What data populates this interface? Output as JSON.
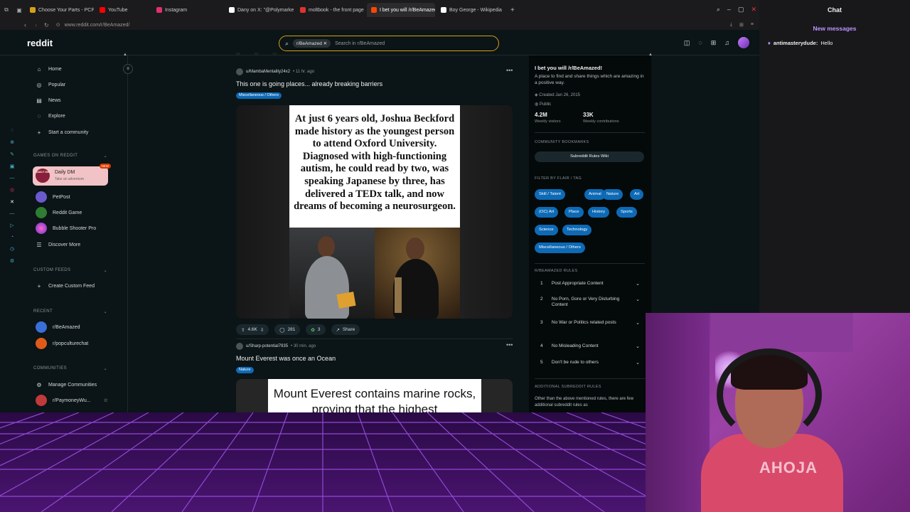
{
  "browser": {
    "tabs": [
      {
        "label": "Choose Your Parts - PCPa",
        "color": "#d4a017"
      },
      {
        "label": "YouTube",
        "color": "#ff0000"
      },
      {
        "label": "Instagram",
        "color": "#e1306c"
      },
      {
        "label": "Dany on X: \"@Polymarke",
        "color": "#ffffff"
      },
      {
        "label": "moltbook - the front page",
        "color": "#e0322f"
      },
      {
        "label": "I bet you will /r/BeAmazed",
        "color": "#ff4500"
      },
      {
        "label": "Boy George - Wikipedia",
        "color": "#ffffff"
      }
    ],
    "active_tab": 5,
    "new_tab": "+",
    "url": "www.reddit.com/r/BeAmazed/"
  },
  "header": {
    "logo": "reddit",
    "search_chip": "r/BeAmazed",
    "search_chip_close": "✕",
    "search_placeholder": "Search in r/BeAmazed"
  },
  "left_nav": {
    "items": [
      {
        "label": "Home",
        "icon": "home-icon",
        "glyph": "⌂"
      },
      {
        "label": "Popular",
        "icon": "popular-icon",
        "glyph": "◎"
      },
      {
        "label": "News",
        "icon": "news-icon",
        "glyph": "▤"
      },
      {
        "label": "Explore",
        "icon": "explore-icon",
        "glyph": "◌"
      },
      {
        "label": "Start a community",
        "icon": "plus-icon",
        "glyph": "+"
      }
    ],
    "games_heading": "GAMES ON REDDIT",
    "games": [
      {
        "label": "Daily DM",
        "sub": "Take an adventure",
        "badge": "NEW",
        "logo": "DAILY DM"
      },
      {
        "label": "PetPost"
      },
      {
        "label": "Reddit Game"
      },
      {
        "label": "Bubble Shooter Pro"
      },
      {
        "label": "Discover More"
      }
    ],
    "feeds_heading": "CUSTOM FEEDS",
    "create_feed": "Create Custom Feed",
    "recent_heading": "RECENT",
    "recent": [
      "r/BeAmazed",
      "r/popculturechat"
    ],
    "communities_heading": "COMMUNITIES",
    "manage": "Manage Communities",
    "community": "r/Paymoney​Wu..."
  },
  "posts": [
    {
      "author": "u/MambaMentality24x2",
      "time": "• 11 hr. ago",
      "title": "This one is going places... already breaking barriers",
      "flair": "Miscellaneous / Others",
      "caption": "At just 6 years old, Joshua Beckford made history as the youngest person to attend Oxford University. Diagnosed with high-functioning autism, he could read by two, was speaking Japanese by three, has delivered a TEDx talk, and now dreams of becoming a neurosurgeon.",
      "votes": "4.6K",
      "comments": "281",
      "awards": "3",
      "share": "Share"
    },
    {
      "author": "u/Sharp-potential7935",
      "time": "• 30 min. ago",
      "title": "Mount Everest was once an Ocean",
      "flair": "Nature",
      "caption": "Mount Everest contains marine rocks, proving that the highest"
    }
  ],
  "right_sidebar": {
    "title": "I bet you will /r/BeAmazed!",
    "description": "A place to find and share things which are amazing in a positive way.",
    "created": "Created Jan 26, 2015",
    "visibility": "Public",
    "stats": [
      {
        "value": "4.2M",
        "label": "Weekly visitors"
      },
      {
        "value": "33K",
        "label": "Weekly contributions"
      }
    ],
    "bookmarks_heading": "COMMUNITY BOOKMARKS",
    "bookmark_button": "Subreddit Rules Wiki",
    "filter_heading": "FILTER BY FLAIR / TAG",
    "flairs": [
      "Skill / Talent",
      "Animal",
      "Nature",
      "Art",
      "(OC) Art",
      "Place",
      "History",
      "Sports",
      "Science",
      "Technology",
      "Miscellaneous / Others"
    ],
    "rules_heading": "R/BEAMAZED RULES",
    "rules": [
      {
        "num": "1",
        "text": "Post Appropriate Content"
      },
      {
        "num": "2",
        "text": "No Porn, Gore or Very Disturbing Content"
      },
      {
        "num": "3",
        "text": "No War or Politics related posts"
      },
      {
        "num": "4",
        "text": "No Misleading Content"
      },
      {
        "num": "5",
        "text": "Don't be rude to others"
      }
    ],
    "additional_heading": "ADDITIONAL SUBREDDIT RULES",
    "additional_text": "Other than the above mentioned rules, there are few additional subreddit rules as"
  },
  "chat": {
    "title": "Chat",
    "new_messages": "New messages",
    "user": "antimasterydude:",
    "message": "Hello"
  },
  "webcam": {
    "shirt_text": "AHOJA"
  }
}
